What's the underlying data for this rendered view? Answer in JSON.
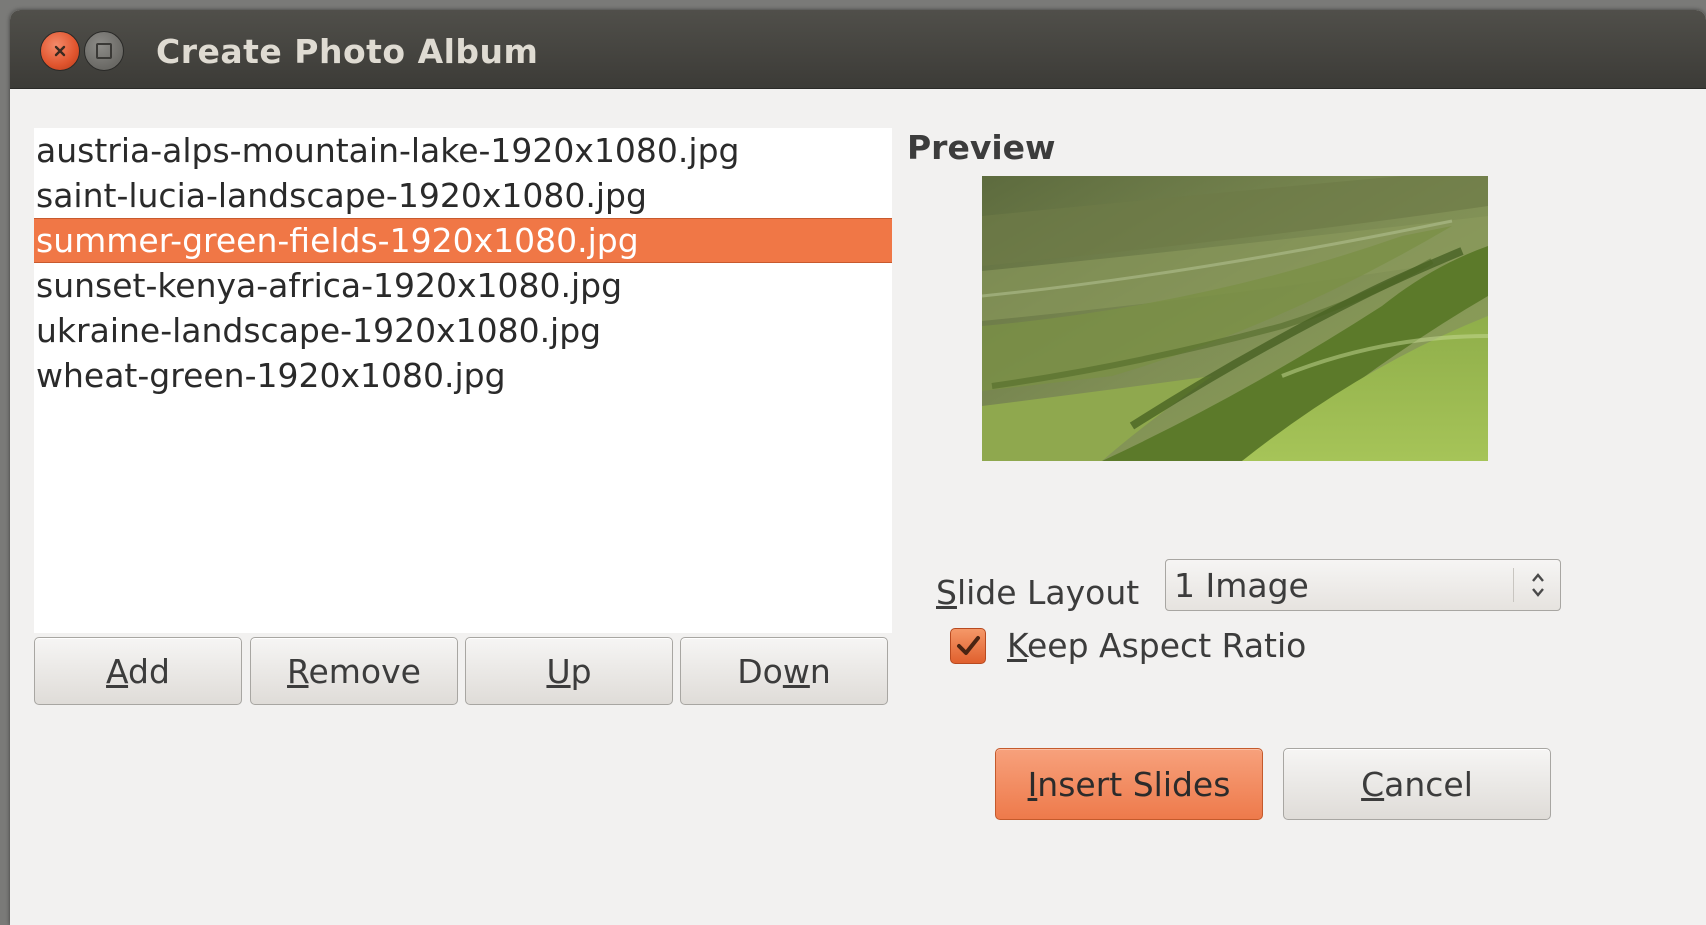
{
  "window": {
    "title": "Create Photo Album"
  },
  "files": [
    {
      "name": "austria-alps-mountain-lake-1920x1080.jpg",
      "selected": false
    },
    {
      "name": "saint-lucia-landscape-1920x1080.jpg",
      "selected": false
    },
    {
      "name": "summer-green-fields-1920x1080.jpg",
      "selected": true
    },
    {
      "name": "sunset-kenya-africa-1920x1080.jpg",
      "selected": false
    },
    {
      "name": "ukraine-landscape-1920x1080.jpg",
      "selected": false
    },
    {
      "name": "wheat-green-1920x1080.jpg",
      "selected": false
    }
  ],
  "list_buttons": {
    "add": {
      "mnemonic": "A",
      "rest": "dd"
    },
    "remove": {
      "mnemonic": "R",
      "rest": "emove"
    },
    "up": {
      "mnemonic": "U",
      "rest": "p"
    },
    "down": {
      "pre": "Do",
      "mnemonic": "w",
      "rest": "n"
    }
  },
  "preview": {
    "label": "Preview",
    "image": "green-fields-photo"
  },
  "slide_layout": {
    "label_mnemonic": "S",
    "label_rest": "lide Layout",
    "value": "1 Image"
  },
  "keep_aspect": {
    "label_mnemonic": "K",
    "label_rest": "eep Aspect Ratio",
    "checked": true
  },
  "actions": {
    "insert": {
      "mnemonic": "I",
      "rest": "nsert Slides"
    },
    "cancel": {
      "mnemonic": "C",
      "rest": "ancel"
    }
  },
  "colors": {
    "accent": "#f07746",
    "titlebar": "#3c3b37",
    "dialog_bg": "#f2f1f0"
  }
}
